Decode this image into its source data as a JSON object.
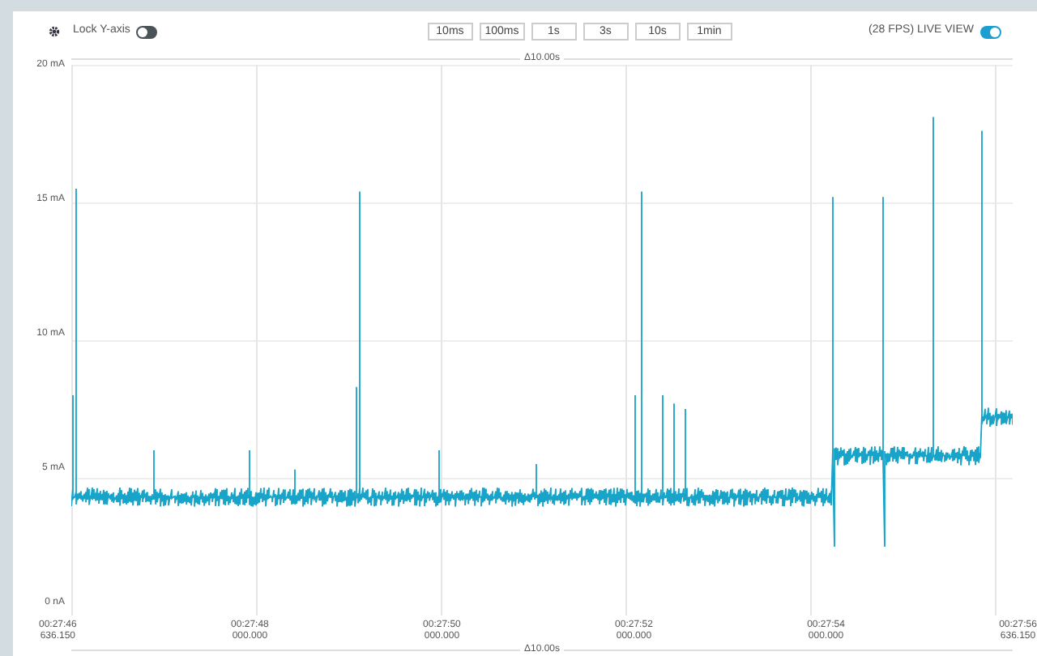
{
  "toolbar": {
    "lock_y_axis": {
      "label": "Lock Y-axis",
      "on": false
    },
    "zoom_buttons": [
      "10ms",
      "100ms",
      "1s",
      "3s",
      "10s",
      "1min"
    ],
    "live_view": {
      "label": "(28 FPS) LIVE VIEW",
      "on": true
    }
  },
  "chart": {
    "span_top": "Δ10.00s",
    "y_labels": [
      "20 mA",
      "15 mA",
      "10 mA",
      "5 mA",
      "0 nA"
    ],
    "x_labels": [
      {
        "time": "00:27:46",
        "sub": "636.150"
      },
      {
        "time": "00:27:48",
        "sub": "000.000"
      },
      {
        "time": "00:27:50",
        "sub": "000.000"
      },
      {
        "time": "00:27:52",
        "sub": "000.000"
      },
      {
        "time": "00:27:54",
        "sub": "000.000"
      },
      {
        "time": "00:27:56",
        "sub": "636.150"
      }
    ],
    "span_bottom": "Δ10.00s"
  }
}
